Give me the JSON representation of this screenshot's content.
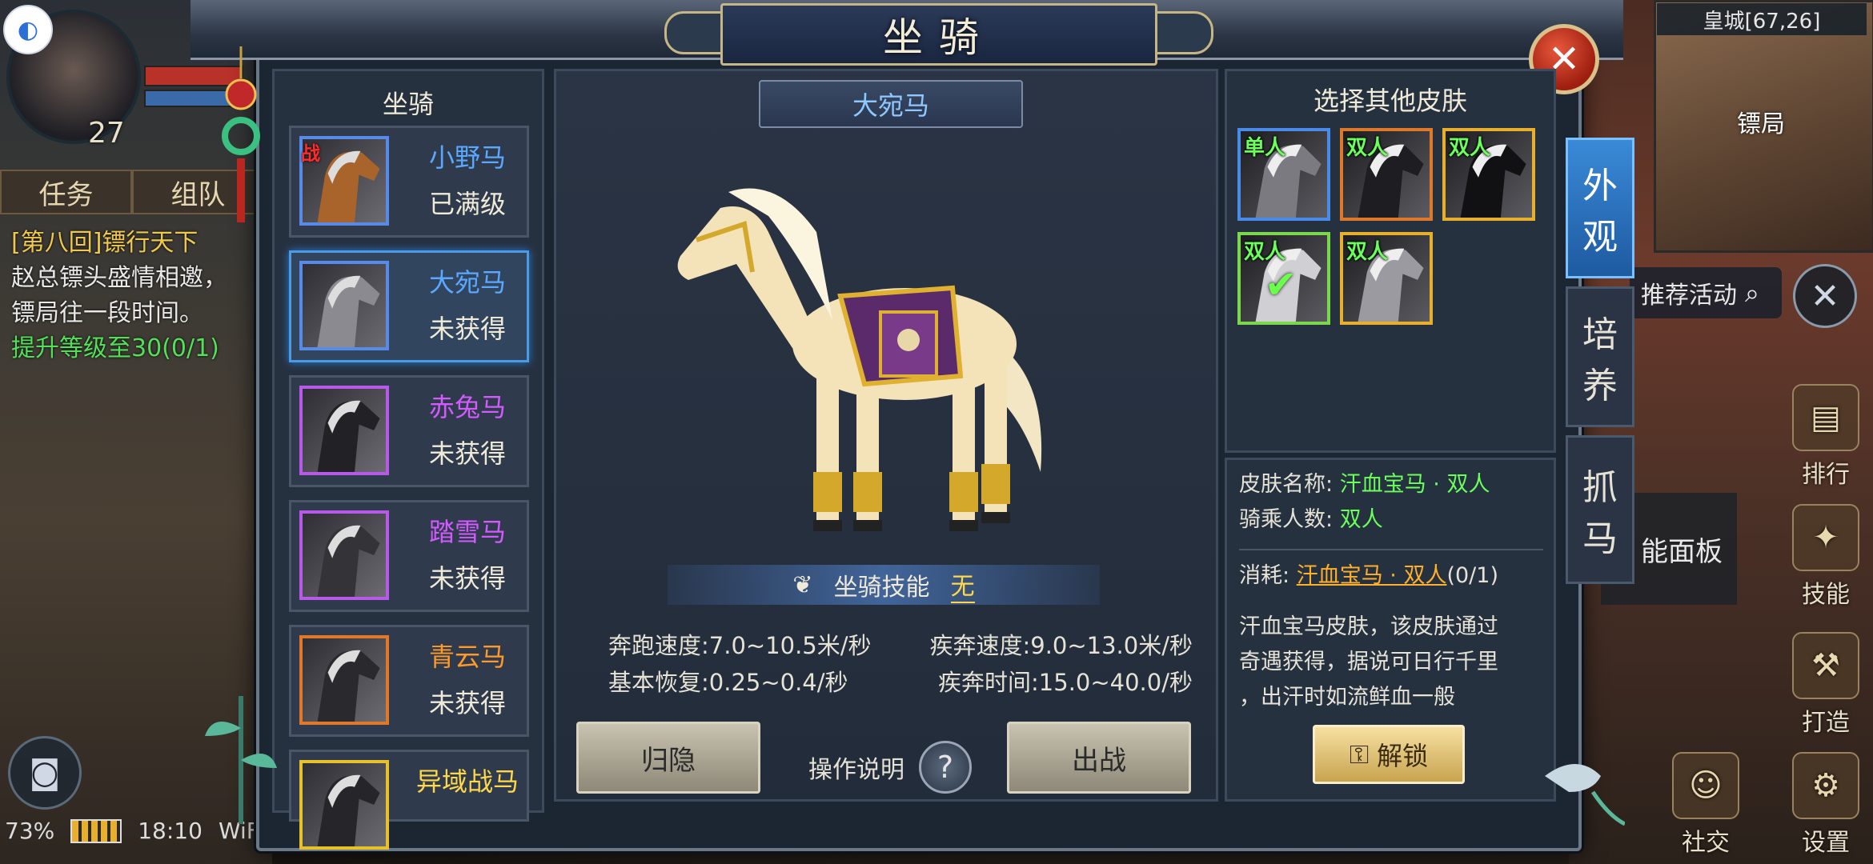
{
  "hud": {
    "level": "27",
    "tabs": [
      "任务",
      "组队"
    ],
    "quest_lines": [
      "[第八回]镖行天下",
      "赵总镖头盛情相邀，",
      "镖局往一段时间。",
      "提升等级至30(0/1)"
    ],
    "battery": "73%",
    "time": "18:10",
    "network": "WiFi"
  },
  "minimap": {
    "title": "皇城[67,26]",
    "marker": "镖局"
  },
  "right_hud": {
    "event_label": "推荐活动",
    "power_panel": "能面板",
    "buttons": [
      "排行",
      "技能",
      "打造",
      "社交",
      "设置"
    ]
  },
  "dialog": {
    "title": "坐骑",
    "left_title": "坐骑",
    "mounts": [
      {
        "name": "小野马",
        "status": "已满级",
        "color": "#5aa8ff",
        "war": "战"
      },
      {
        "name": "大宛马",
        "status": "未获得",
        "color": "#5aa8ff",
        "war": ""
      },
      {
        "name": "赤兔马",
        "status": "未获得",
        "color": "#d25aff",
        "war": ""
      },
      {
        "name": "踏雪马",
        "status": "未获得",
        "color": "#d25aff",
        "war": ""
      },
      {
        "name": "青云马",
        "status": "未获得",
        "color": "#ff9a2a",
        "war": ""
      },
      {
        "name": "异域战马",
        "status": "",
        "color": "#ffd84a",
        "war": ""
      }
    ],
    "selected_mount": "大宛马",
    "skill_label": "坐骑技能",
    "skill_value": "无",
    "stats": {
      "run_speed": "奔跑速度:7.0~10.5米/秒",
      "sprint_speed": "疾奔速度:9.0~13.0米/秒",
      "recovery": "基本恢复:0.25~0.4/秒",
      "sprint_time": "疾奔时间:15.0~40.0/秒"
    },
    "btn_hide": "归隐",
    "help_label": "操作说明",
    "help_icon": "?",
    "btn_battle": "出战",
    "skins_title": "选择其他皮肤",
    "skins": [
      {
        "tag": "单人",
        "border": "#4a8ae8"
      },
      {
        "tag": "双人",
        "border": "#e0782a"
      },
      {
        "tag": "双人",
        "border": "#e8b02a"
      },
      {
        "tag": "双人",
        "border": "#7ad84a",
        "checked": true
      },
      {
        "tag": "双人",
        "border": "#e8b02a"
      }
    ],
    "skin_name_label": "皮肤名称:",
    "skin_name_value": "汗血宝马 · 双人",
    "riders_label": "骑乘人数:",
    "riders_value": "双人",
    "cost_label": "消耗:",
    "cost_item": "汗血宝马 · 双人",
    "cost_count": "(0/1)",
    "description": [
      "汗血宝马皮肤，该皮肤通过",
      "奇遇获得，据说可日行千里",
      "，出汗时如流鲜血一般"
    ],
    "unlock_label": "解锁",
    "side_tabs": [
      {
        "label": "外观",
        "chars": [
          "外",
          "观"
        ]
      },
      {
        "label": "培养",
        "chars": [
          "培",
          "养"
        ]
      },
      {
        "label": "抓马",
        "chars": [
          "抓",
          "马"
        ]
      }
    ]
  }
}
